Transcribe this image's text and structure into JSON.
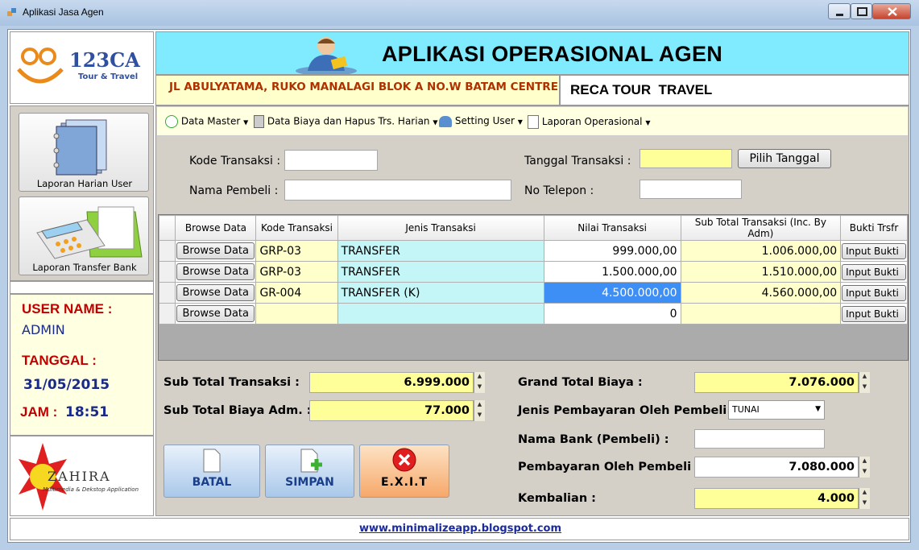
{
  "window": {
    "title": "Aplikasi Jasa Agen"
  },
  "header": {
    "logo_text": "123CA",
    "logo_sub": "Tour & Travel",
    "app_title": "APLIKASI OPERASIONAL AGEN",
    "address": "JL ABULYATAMA, RUKO MANALAGI BLOK A NO.W BATAM CENTRE",
    "company": "RECA TOUR  TRAVEL"
  },
  "sidebar": {
    "buttons": [
      {
        "label": "Laporan Harian User"
      },
      {
        "label": "Laporan Transfer Bank"
      }
    ],
    "user_name_label": "USER NAME :",
    "user_name": "ADMIN",
    "tanggal_label": "TANGGAL :",
    "tanggal": "31/05/2015",
    "jam_label": "JAM :",
    "jam": "18:51",
    "brand": "ZAHIRA",
    "brand_sub": "Multimedia & Dekstop Application"
  },
  "menu": {
    "items": [
      {
        "label": "Data Master"
      },
      {
        "label": "Data Biaya dan Hapus Trs. Harian"
      },
      {
        "label": "Setting User"
      },
      {
        "label": "Laporan Operasional"
      }
    ]
  },
  "form": {
    "kode_label": "Kode Transaksi :",
    "kode_value": "",
    "tanggal_label": "Tanggal Transaksi :",
    "tanggal_value": "",
    "pilih_tanggal": "Pilih Tanggal",
    "nama_label": "Nama Pembeli :",
    "nama_value": "",
    "telepon_label": "No Telepon :",
    "telepon_value": ""
  },
  "grid": {
    "headers": [
      "Browse Data",
      "Kode Transaksi",
      "Jenis Transaksi",
      "Nilai Transaksi",
      "Sub Total Transaksi (Inc. By Adm)",
      "Bukti Trsfr"
    ],
    "browse_label": "Browse Data",
    "input_label": "Input Bukti",
    "rows": [
      {
        "kode": "GRP-03",
        "jenis": "TRANSFER",
        "nilai": "999.000,00",
        "subtotal": "1.006.000,00"
      },
      {
        "kode": "GRP-03",
        "jenis": "TRANSFER",
        "nilai": "1.500.000,00",
        "subtotal": "1.510.000,00"
      },
      {
        "kode": "GR-004",
        "jenis": "TRANSFER (K)",
        "nilai": "4.500.000,00",
        "subtotal": "4.560.000,00"
      },
      {
        "kode": "",
        "jenis": "",
        "nilai": "0",
        "subtotal": ""
      }
    ]
  },
  "totals": {
    "sub_total_label": "Sub Total Transaksi :",
    "sub_total": "6.999.000",
    "biaya_adm_label": "Sub Total Biaya Adm. :",
    "biaya_adm": "77.000",
    "grand_total_label": "Grand Total Biaya :",
    "grand_total": "7.076.000",
    "jenis_bayar_label": "Jenis Pembayaran Oleh Pembeli :",
    "jenis_bayar": "TUNAI",
    "nama_bank_label": "Nama Bank (Pembeli) :",
    "nama_bank": "",
    "pembayaran_label": "Pembayaran Oleh Pembeli :",
    "pembayaran": "7.080.000",
    "kembalian_label": "Kembalian :",
    "kembalian": "4.000"
  },
  "actions": {
    "batal": "BATAL",
    "simpan": "SIMPAN",
    "exit": "E.X.I.T"
  },
  "footer": {
    "link": "www.minimalizeapp.blogspot.com"
  },
  "colors": {
    "header_cyan": "#80eaff",
    "yellow_field": "#ffff99",
    "selected_cell": "#3d8ef5"
  }
}
